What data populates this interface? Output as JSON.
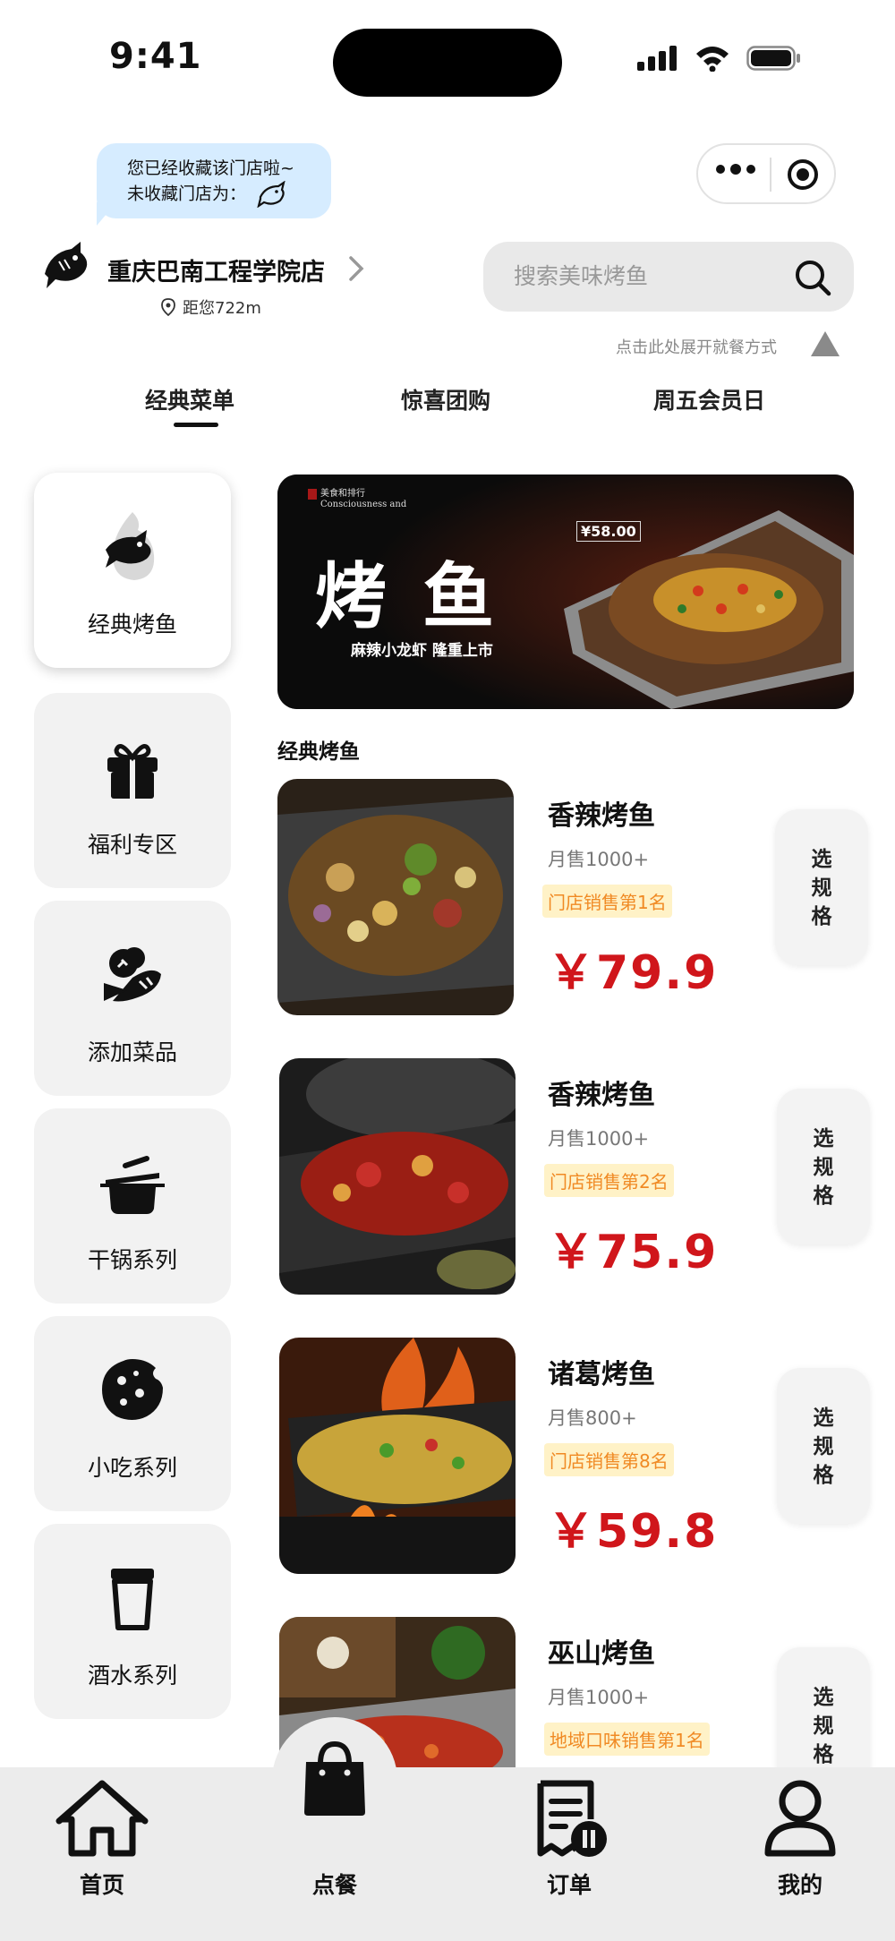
{
  "status_bar": {
    "time": "9:41"
  },
  "header": {
    "fav_bubble": {
      "line1": "您已经收藏该门店啦~",
      "line2": "未收藏门店为："
    },
    "store_name": "重庆巴南工程学院店",
    "distance": "距您722m",
    "search_placeholder": "搜索美味烤鱼",
    "expand_hint": "点击此处展开就餐方式"
  },
  "tabs": [
    {
      "label": "经典菜单",
      "active": true
    },
    {
      "label": "惊喜团购",
      "active": false
    },
    {
      "label": "周五会员日",
      "active": false
    }
  ],
  "sidebar": {
    "items": [
      {
        "label": "经典烤鱼",
        "icon": "fish-icon",
        "active": true
      },
      {
        "label": "福利专区",
        "icon": "gift-icon",
        "active": false
      },
      {
        "label": "添加菜品",
        "icon": "vegetables-icon",
        "active": false
      },
      {
        "label": "干锅系列",
        "icon": "pot-icon",
        "active": false
      },
      {
        "label": "小吃系列",
        "icon": "cookie-icon",
        "active": false
      },
      {
        "label": "酒水系列",
        "icon": "cup-icon",
        "active": false
      }
    ]
  },
  "banner": {
    "title": "烤鱼",
    "tagline": "麻辣小龙虾 隆重上市",
    "price_badge": "¥58.00",
    "small_caption": "美食和排行",
    "english": "Consciousness and"
  },
  "section_title": "经典烤鱼",
  "products": [
    {
      "name": "香辣烤鱼",
      "sales": "月售1000+",
      "rank": "门店销售第1名",
      "price": "￥79.9",
      "spec": [
        "选",
        "规",
        "格"
      ]
    },
    {
      "name": "香辣烤鱼",
      "sales": "月售1000+",
      "rank": "门店销售第2名",
      "price": "￥75.9",
      "spec": [
        "选",
        "规",
        "格"
      ]
    },
    {
      "name": "诸葛烤鱼",
      "sales": "月售800+",
      "rank": "门店销售第8名",
      "price": "￥59.8",
      "spec": [
        "选",
        "规",
        "格"
      ]
    },
    {
      "name": "巫山烤鱼",
      "sales": "月售1000+",
      "rank": "地域口味销售第1名",
      "price": "",
      "spec": [
        "选",
        "规",
        "格"
      ]
    }
  ],
  "bottom_nav": [
    {
      "label": "首页",
      "icon": "home-icon"
    },
    {
      "label": "点餐",
      "icon": "shopping-bag-icon"
    },
    {
      "label": "订单",
      "icon": "order-icon"
    },
    {
      "label": "我的",
      "icon": "user-icon"
    }
  ],
  "colors": {
    "price": "#d0161b",
    "rank_text": "#f08a24",
    "rank_bg": "#fff2c7",
    "bubble": "#d6ecff",
    "nav_bg": "#ececec"
  }
}
